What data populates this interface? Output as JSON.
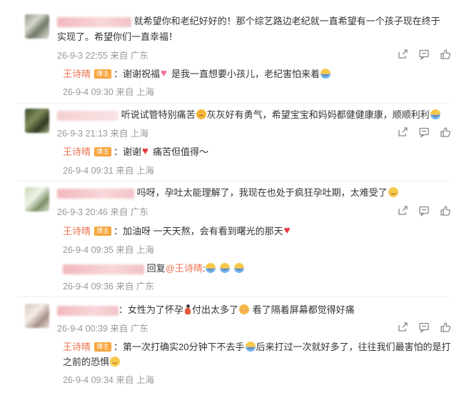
{
  "comments": [
    {
      "text": "就希望你和老纪好好的！那个综艺路边老纪就一直希望有一个孩子现在终于",
      "text_cont": "实现了。希望你们一直幸福！",
      "date": "26-9-3 22:55",
      "from": "来自",
      "location": "广东",
      "reply": {
        "author": "王诗晴",
        "badge": "博主",
        "text_a": "：谢谢祝福",
        "text_b": "是我一直想要小孩儿，老纪害怕来着",
        "date": "26-9-4 09:30",
        "from": "来自",
        "location": "上海"
      }
    },
    {
      "text": "听说试管特别痛苦",
      "text_b": "灰灰好有勇气，希望宝宝和妈妈都健健康康，顺顺利利",
      "date": "26-9-3 21:13",
      "from": "来自",
      "location": "上海",
      "reply": {
        "author": "王诗晴",
        "badge": "博主",
        "text_a": "：谢谢",
        "text_b": "痛苦但值得～",
        "date": "26-9-4 09:31",
        "from": "来自",
        "location": "上海"
      }
    },
    {
      "text": "吗呀，孕吐太能理解了，我现在也处于疯狂孕吐期，太难受了",
      "date": "26-9-3 20:46",
      "from": "来自",
      "location": "广东",
      "reply": {
        "author": "王诗晴",
        "badge": "博主",
        "text_a": "：加油呀 一天天熬，会有看到曙光的那天",
        "date": "26-9-4 09:35",
        "from": "来自",
        "location": "上海"
      },
      "reply2": {
        "prefix": "回复",
        "mention": "@王诗晴",
        "suffix": ":",
        "date": "26-9-4 09:36",
        "from": "来自",
        "location": "广东"
      }
    },
    {
      "text": "：女性为了怀孕",
      "text_b": "付出太多了",
      "text_c": " 看了隔着屏幕都觉得好痛",
      "date": "26-9-4 00:39",
      "from": "来自",
      "location": "广东",
      "reply": {
        "author": "王诗晴",
        "badge": "博主",
        "text_a": "：第一次打确实20分钟下不去手",
        "text_b": "后来打过一次就好多了，往往我们最害怕的是打",
        "text_cont": "之前的恐惧",
        "date": "26-9-4 09:34",
        "from": "来自",
        "location": "上海"
      }
    }
  ],
  "icons": [
    "share-icon",
    "comment-icon",
    "like-icon"
  ],
  "colors": {
    "author": "#eb7350",
    "meta": "#999999",
    "text": "#333333",
    "badge": "#f7a43b"
  }
}
